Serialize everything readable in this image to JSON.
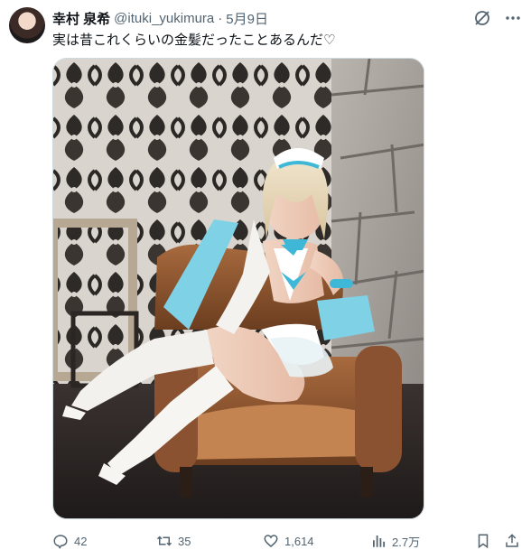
{
  "author": {
    "display_name": "幸村 泉希",
    "handle": "@ituki_yukimura",
    "separator": "·",
    "date": "5月9日"
  },
  "tweet": {
    "text": "実は昔これくらいの金髪だったことあるんだ♡"
  },
  "icons": {
    "header_action": "grok-icon",
    "more": "more-icon",
    "reply": "reply-icon",
    "retweet": "retweet-icon",
    "like": "heart-icon",
    "views": "views-icon",
    "bookmark": "bookmark-icon",
    "share": "share-icon"
  },
  "metrics": {
    "replies": "42",
    "retweets": "35",
    "likes": "1,614",
    "views": "2.7万"
  },
  "colors": {
    "text_primary": "#0f1419",
    "text_secondary": "#536471",
    "accent_cyan": "#3fb8d8"
  }
}
